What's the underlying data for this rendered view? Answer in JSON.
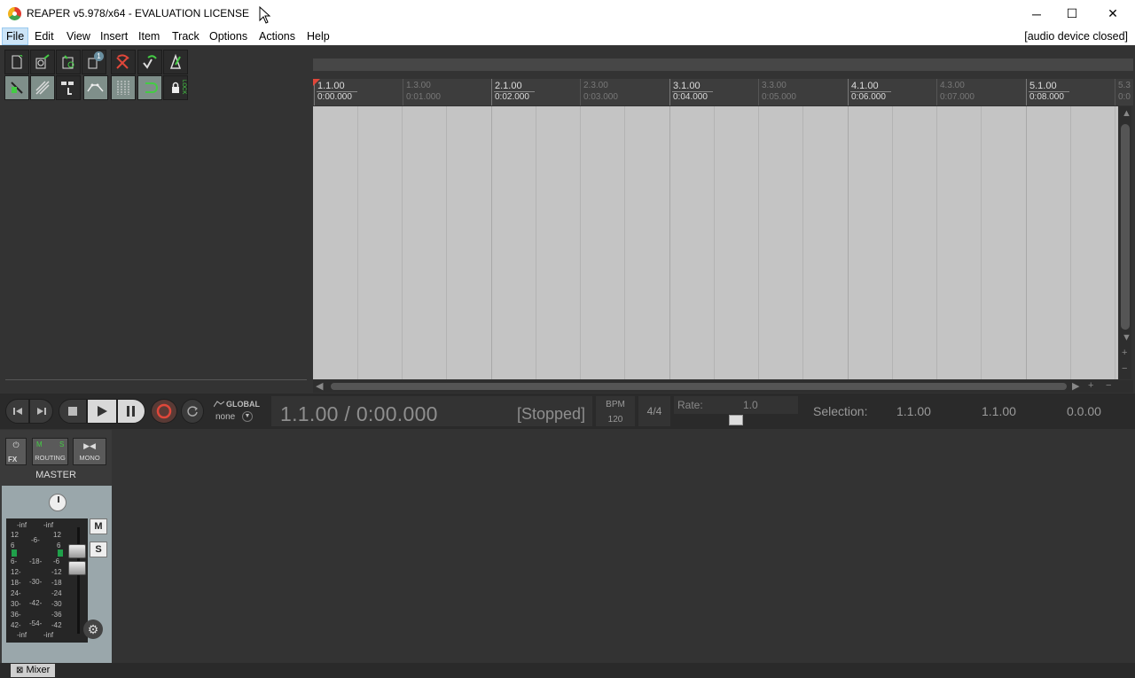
{
  "window": {
    "title": "REAPER v5.978/x64 - EVALUATION LICENSE",
    "minimize": "─",
    "maximize": "☐",
    "close": "✕"
  },
  "menu": {
    "items": [
      "File",
      "Edit",
      "View",
      "Insert",
      "Item",
      "Track",
      "Options",
      "Actions",
      "Help"
    ],
    "status": "[audio device closed]"
  },
  "toolbar": {
    "row1": [
      "new-project-icon",
      "open-project-icon",
      "save-project-icon",
      "project-settings-icon",
      "undo-icon",
      "redo-icon",
      "metronome-icon"
    ],
    "row2": [
      "snap-icon",
      "ripple-icon",
      "grouping-icon",
      "envelope-icon",
      "grid-icon",
      "loop-icon",
      "lock-icon"
    ],
    "badge": "1",
    "lock_label": "LOCK"
  },
  "ruler": {
    "major": [
      {
        "label": "1.1.00",
        "time": "0:00.000"
      },
      {
        "label": "2.1.00",
        "time": "0:02.000"
      },
      {
        "label": "3.1.00",
        "time": "0:04.000"
      },
      {
        "label": "4.1.00",
        "time": "0:06.000"
      },
      {
        "label": "5.1.00",
        "time": "0:08.000"
      }
    ],
    "minor": [
      {
        "label": "1.3.00",
        "time": "0:01.000"
      },
      {
        "label": "2.3.00",
        "time": "0:03.000"
      },
      {
        "label": "3.3.00",
        "time": "0:05.000"
      },
      {
        "label": "4.3.00",
        "time": "0:07.000"
      },
      {
        "label": "5.3",
        "time": "0:0"
      }
    ]
  },
  "transport": {
    "global_label": "GLOBAL",
    "global_value": "none",
    "time": "1.1.00 / 0:00.000",
    "status": "[Stopped]",
    "bpm_label": "BPM",
    "bpm_value": "120",
    "time_sig": "4/4",
    "rate_label": "Rate:",
    "rate_value": "1.0",
    "selection_label": "Selection:",
    "selection_start": "1.1.00",
    "selection_end": "1.1.00",
    "selection_length": "0.0.00"
  },
  "mixer": {
    "fx_label": "FX",
    "routing_label": "ROUTING",
    "mono_label": "MONO",
    "m_small": "M",
    "s_small": "S",
    "master_label": "MASTER",
    "mute": "M",
    "solo": "S",
    "meter_top_left": "-inf",
    "meter_top_right": "-inf",
    "meter_scale_left": [
      "12",
      "6",
      "-",
      "6-",
      "12-",
      "18-",
      "24-",
      "30-",
      "36-",
      "42-"
    ],
    "meter_scale_mid": [
      "-6-",
      "-18-",
      "-30-",
      "-42-",
      "-54-"
    ],
    "meter_scale_right": [
      "12",
      "6",
      "-",
      "-6",
      "-12",
      "-18",
      "-24",
      "-30",
      "-36",
      "-42"
    ],
    "meter_bottom_left": "-inf",
    "meter_bottom_right": "-inf"
  },
  "tabs": {
    "mixer": "Mixer"
  },
  "colors": {
    "arrange_bg": "#c4c4c4",
    "meter_led": "#1fa04a",
    "record": "#e0473a"
  }
}
